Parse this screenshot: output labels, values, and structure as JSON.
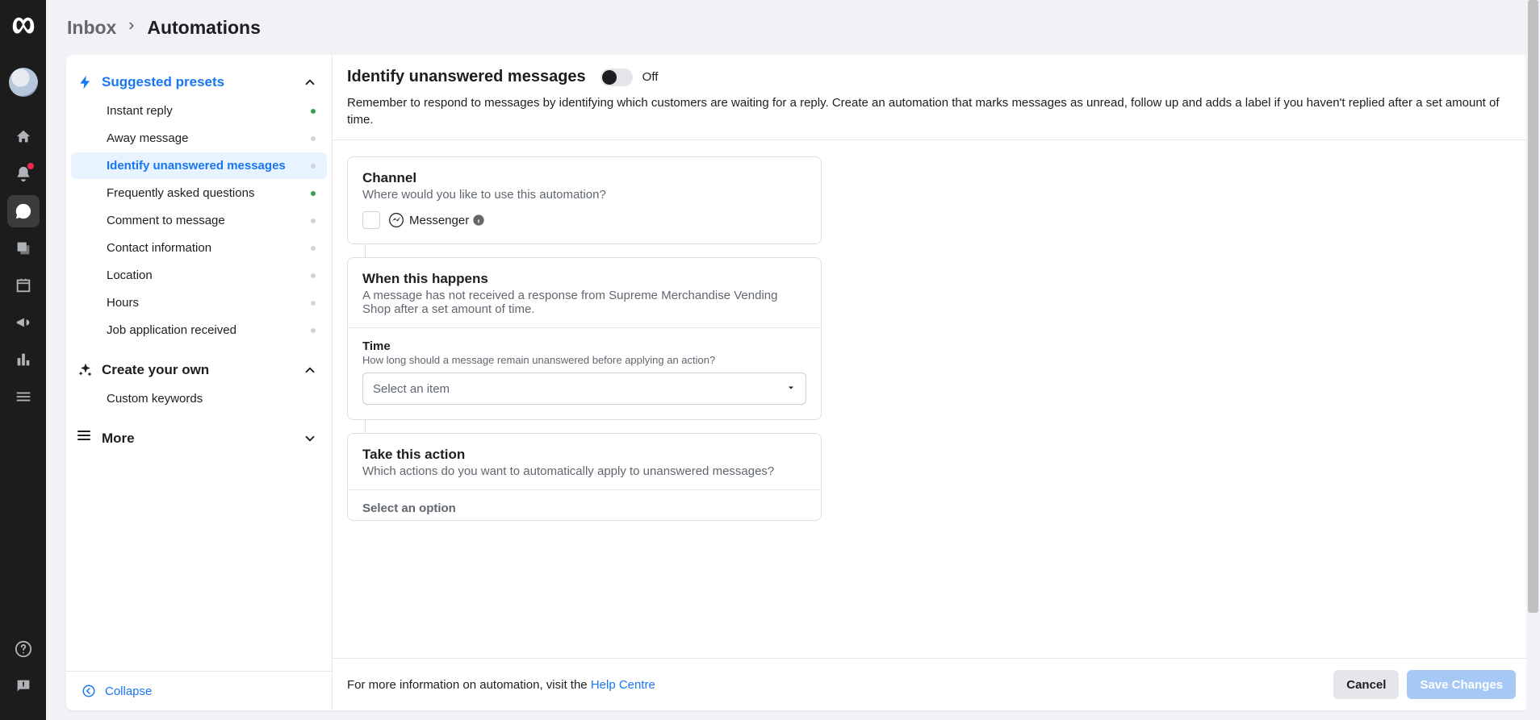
{
  "breadcrumb": {
    "parent": "Inbox",
    "current": "Automations"
  },
  "sidebar": {
    "presets_header": "Suggested presets",
    "items": [
      {
        "label": "Instant reply",
        "status": "on"
      },
      {
        "label": "Away message",
        "status": "off"
      },
      {
        "label": "Identify unanswered messages",
        "status": "off",
        "active": true
      },
      {
        "label": "Frequently asked questions",
        "status": "on"
      },
      {
        "label": "Comment to message",
        "status": "off"
      },
      {
        "label": "Contact information",
        "status": "off"
      },
      {
        "label": "Location",
        "status": "off"
      },
      {
        "label": "Hours",
        "status": "off"
      },
      {
        "label": "Job application received",
        "status": "off"
      }
    ],
    "create_header": "Create your own",
    "create_items": [
      {
        "label": "Custom keywords"
      }
    ],
    "more_header": "More",
    "collapse_label": "Collapse"
  },
  "automation": {
    "title": "Identify unanswered messages",
    "toggle_state": "Off",
    "description": "Remember to respond to messages by identifying which customers are waiting for a reply. Create an automation that marks messages as unread, follow up and adds a label if you haven't replied after a set amount of time.",
    "channel": {
      "title": "Channel",
      "subtitle": "Where would you like to use this automation?",
      "option_label": "Messenger"
    },
    "trigger": {
      "title": "When this happens",
      "description": "A message has not received a response from Supreme Merchandise Vending Shop after a set amount of time."
    },
    "time": {
      "label": "Time",
      "help": "How long should a message remain unanswered before applying an action?",
      "placeholder": "Select an item"
    },
    "action": {
      "title": "Take this action",
      "subtitle": "Which actions do you want to automatically apply to unanswered messages?",
      "select_label": "Select an option"
    }
  },
  "footer": {
    "prefix": "For more information on automation, visit the ",
    "link": "Help Centre",
    "cancel": "Cancel",
    "save": "Save Changes"
  }
}
